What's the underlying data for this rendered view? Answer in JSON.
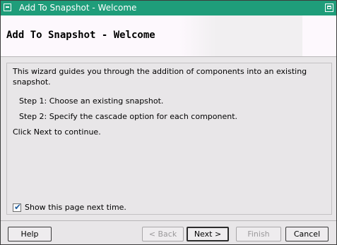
{
  "window": {
    "title": "Add To Snapshot - Welcome",
    "title_bar_color": "#1f9d7a"
  },
  "header": {
    "title": "Add To Snapshot - Welcome"
  },
  "content": {
    "intro_line1": "This wizard guides you through the addition of components into an existing",
    "intro_line2": "snapshot.",
    "step1": "Step 1: Choose an existing snapshot.",
    "step2": "Step 2: Specify the cascade option for each component.",
    "closing": "Click Next to continue."
  },
  "checkbox": {
    "label": "Show this page next time.",
    "checked": true
  },
  "buttons": {
    "help": "Help",
    "back": "< Back",
    "next": "Next >",
    "finish": "Finish",
    "cancel": "Cancel"
  }
}
